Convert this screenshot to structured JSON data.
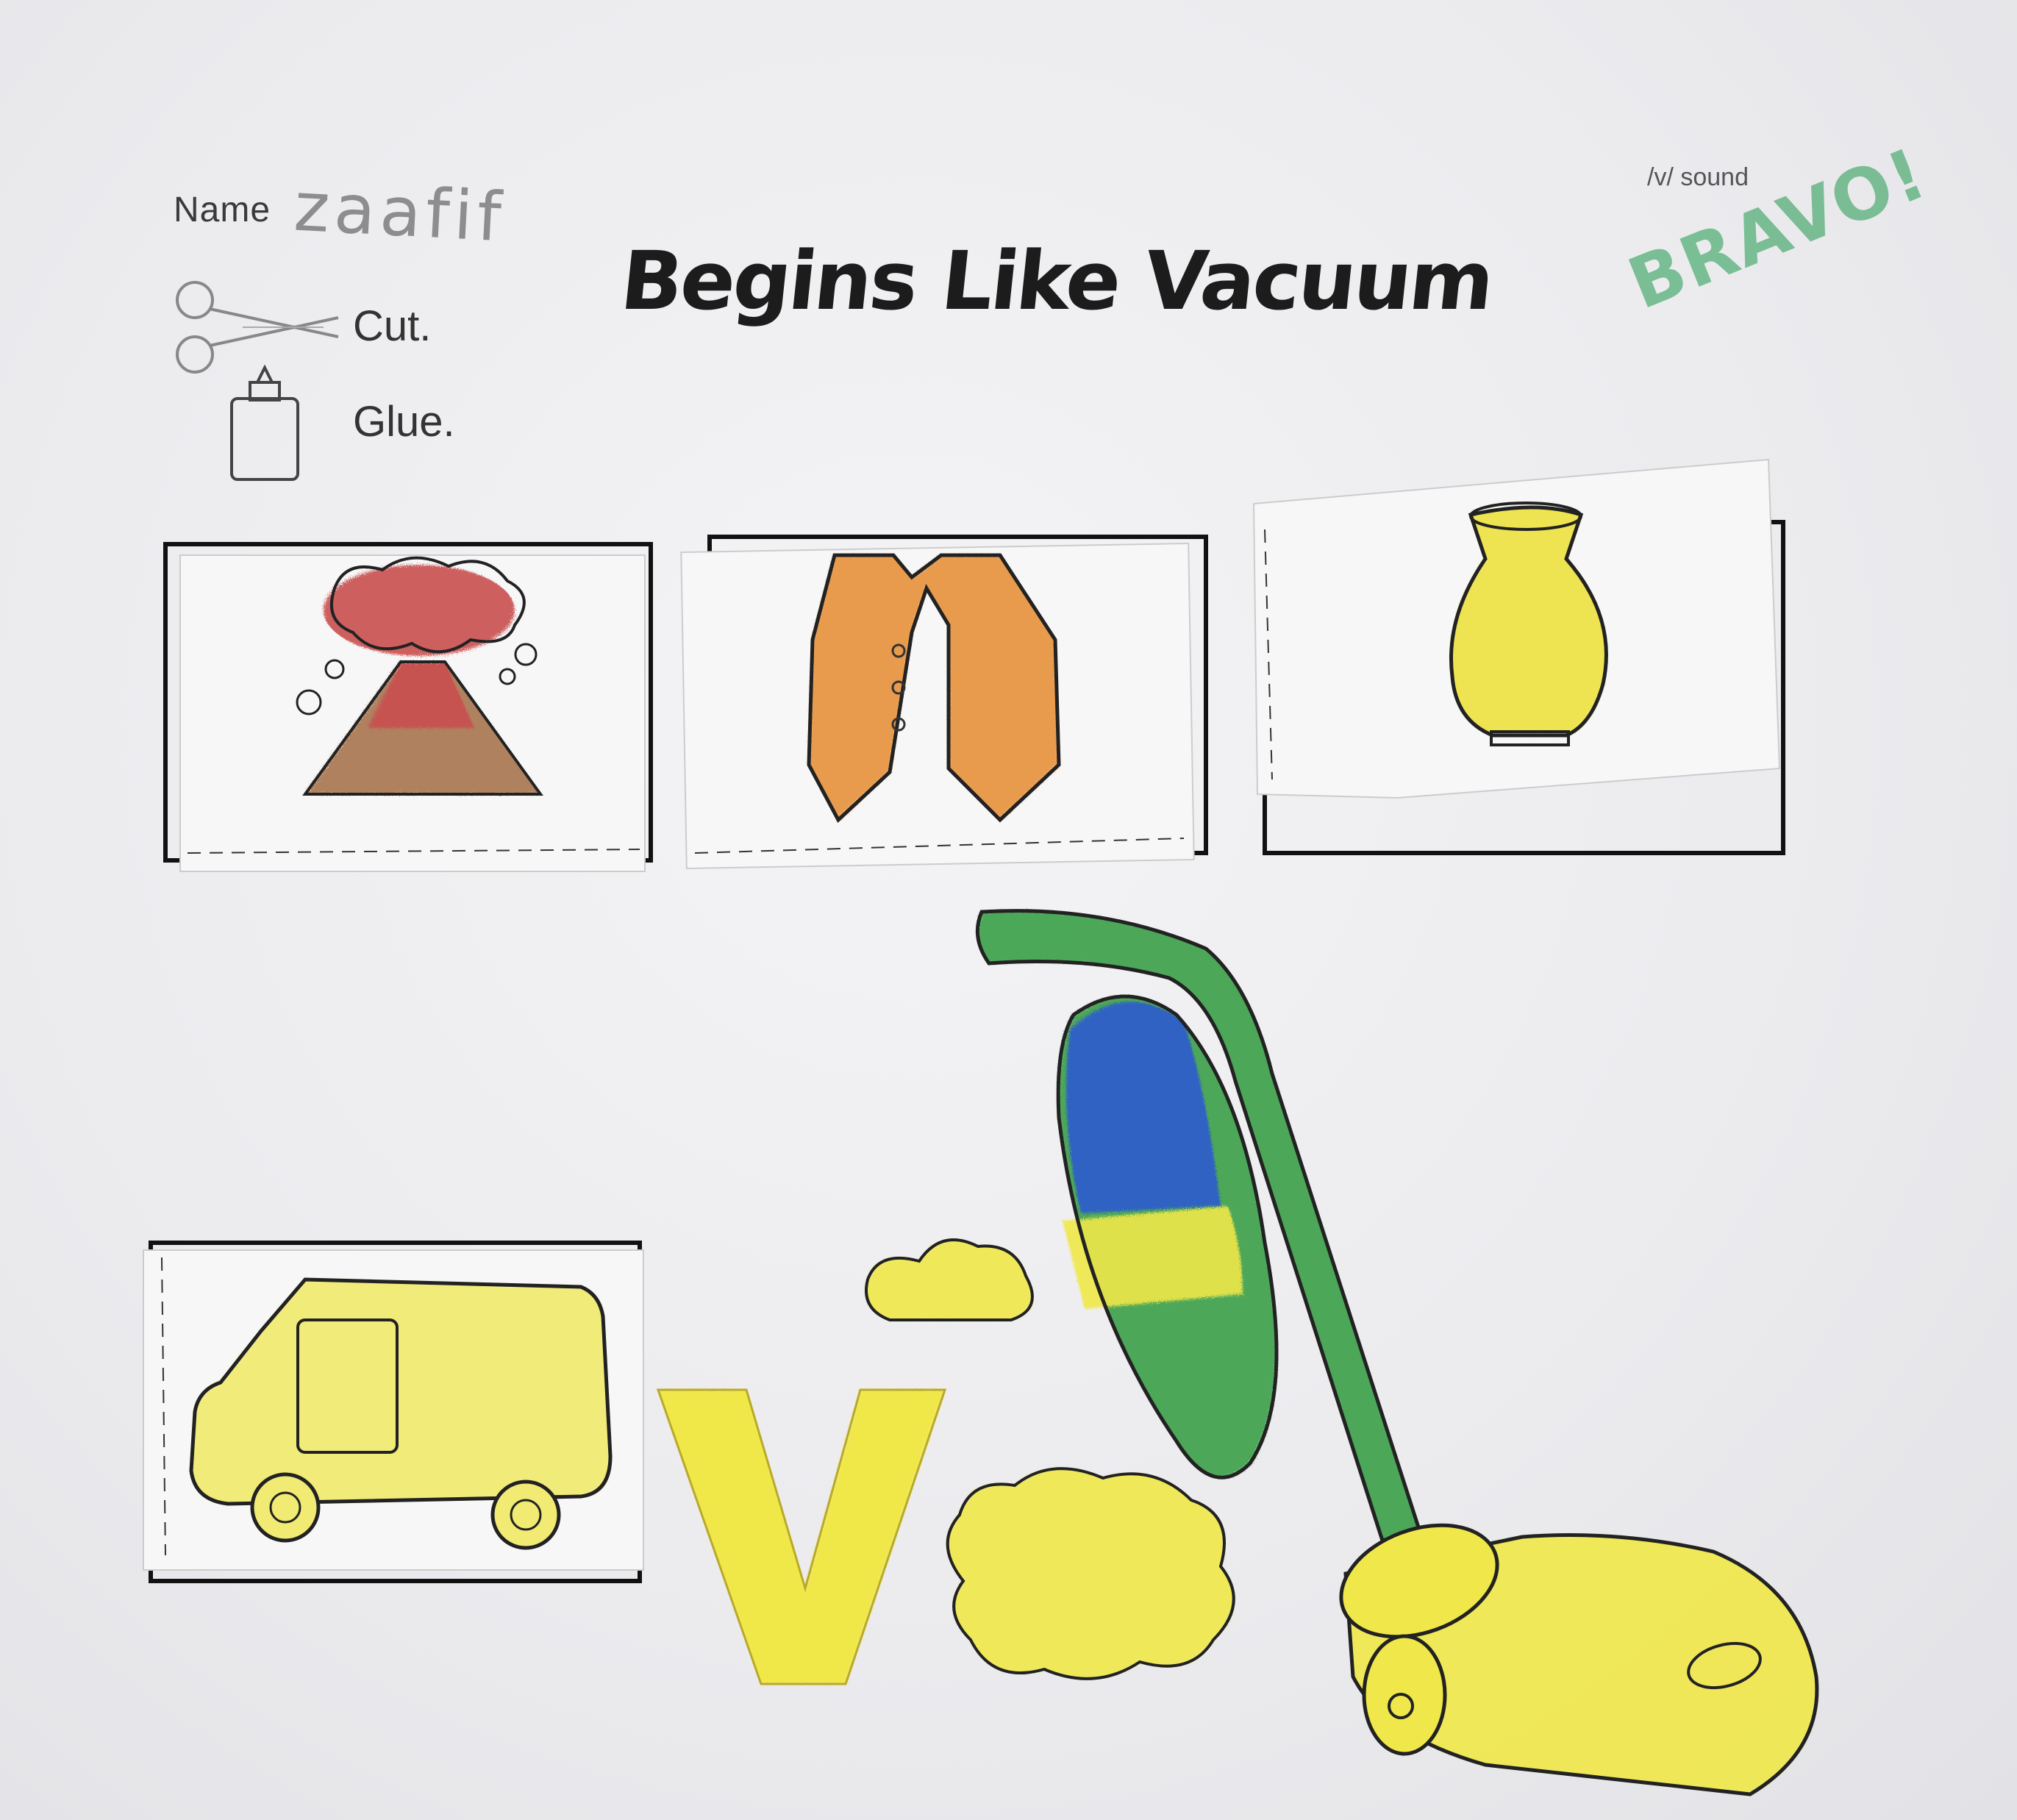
{
  "worksheet": {
    "name_label": "Name",
    "name_value": "zaafif",
    "title": "Begins Like Vacuum",
    "instructions": {
      "cut": "Cut.",
      "glue": "Glue."
    },
    "sound_label": "/v/ sound",
    "stamp": "BRAVO!"
  },
  "pictures": [
    {
      "subject": "volcano",
      "color": "#c94f4f"
    },
    {
      "subject": "vest",
      "color": "#e8923a"
    },
    {
      "subject": "vase",
      "color": "#eee24a"
    },
    {
      "subject": "van",
      "color": "#f1eb73"
    }
  ],
  "letter": "V",
  "colors": {
    "vacuum_green": "#3aa04a",
    "vacuum_blue": "#2f5fc8",
    "crayon_yellow": "#f0e84a",
    "stamp_green": "#5fb37f"
  }
}
